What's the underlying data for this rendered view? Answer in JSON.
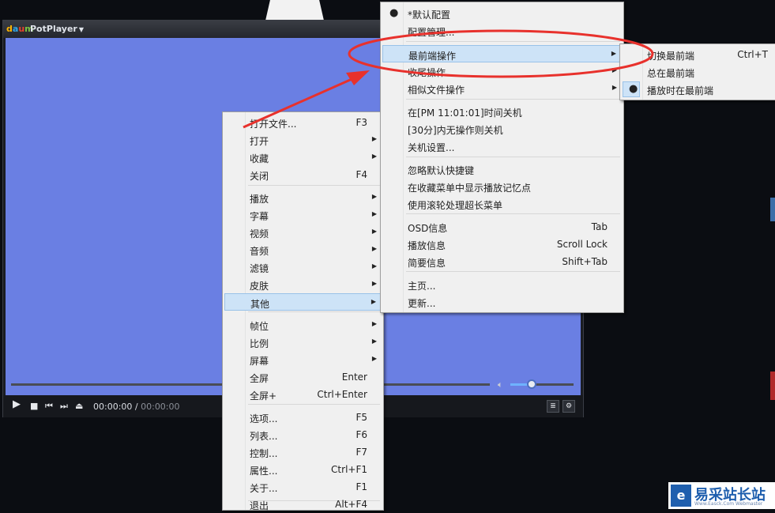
{
  "player": {
    "app_name": "PotPlayer",
    "current_time": "00:00:00 /",
    "duration": "00:00:00"
  },
  "main_menu": {
    "items": [
      {
        "label": "打开文件...",
        "key": "F3",
        "submenu": false
      },
      {
        "label": "打开",
        "key": "",
        "submenu": true
      },
      {
        "label": "收藏",
        "key": "",
        "submenu": true
      },
      {
        "label": "关闭",
        "key": "F4",
        "submenu": false
      },
      {
        "label": "播放",
        "key": "",
        "submenu": true
      },
      {
        "label": "字幕",
        "key": "",
        "submenu": true
      },
      {
        "label": "视频",
        "key": "",
        "submenu": true
      },
      {
        "label": "音频",
        "key": "",
        "submenu": true
      },
      {
        "label": "滤镜",
        "key": "",
        "submenu": true
      },
      {
        "label": "皮肤",
        "key": "",
        "submenu": true
      },
      {
        "label": "其他",
        "key": "",
        "submenu": true,
        "highlighted": true
      },
      {
        "label": "帧位",
        "key": "",
        "submenu": true
      },
      {
        "label": "比例",
        "key": "",
        "submenu": true
      },
      {
        "label": "屏幕",
        "key": "",
        "submenu": true
      },
      {
        "label": "全屏",
        "key": "Enter",
        "submenu": false
      },
      {
        "label": "全屏+",
        "key": "Ctrl+Enter",
        "submenu": false
      },
      {
        "label": "选项...",
        "key": "F5",
        "submenu": false
      },
      {
        "label": "列表...",
        "key": "F6",
        "submenu": false
      },
      {
        "label": "控制...",
        "key": "F7",
        "submenu": false
      },
      {
        "label": "属性...",
        "key": "Ctrl+F1",
        "submenu": false
      },
      {
        "label": "关于...",
        "key": "F1",
        "submenu": false
      },
      {
        "label": "退出",
        "key": "Alt+F4",
        "submenu": false
      }
    ]
  },
  "other_menu": {
    "items": [
      {
        "label": "*默认配置",
        "key": "",
        "submenu": false,
        "checked": true
      },
      {
        "label": "配置管理...",
        "key": "",
        "submenu": false
      },
      {
        "label": "最前端操作",
        "key": "",
        "submenu": true,
        "highlighted": true
      },
      {
        "label": "收尾操作",
        "key": "",
        "submenu": true
      },
      {
        "label": "相似文件操作",
        "key": "",
        "submenu": true
      },
      {
        "label": "在[PM 11:01:01]时间关机",
        "key": "",
        "submenu": false
      },
      {
        "label": "[30分]内无操作则关机",
        "key": "",
        "submenu": false
      },
      {
        "label": "关机设置...",
        "key": "",
        "submenu": false
      },
      {
        "label": "忽略默认快捷键",
        "key": "",
        "submenu": false
      },
      {
        "label": "在收藏菜单中显示播放记忆点",
        "key": "",
        "submenu": false
      },
      {
        "label": "使用滚轮处理超长菜单",
        "key": "",
        "submenu": false
      },
      {
        "label": "OSD信息",
        "key": "Tab",
        "submenu": false
      },
      {
        "label": "播放信息",
        "key": "Scroll Lock",
        "submenu": false
      },
      {
        "label": "简要信息",
        "key": "Shift+Tab",
        "submenu": false
      },
      {
        "label": "主页...",
        "key": "",
        "submenu": false
      },
      {
        "label": "更新...",
        "key": "",
        "submenu": false
      }
    ]
  },
  "topmost_menu": {
    "items": [
      {
        "label": "切换最前端",
        "key": "Ctrl+T",
        "checked": false
      },
      {
        "label": "总在最前端",
        "key": "",
        "checked": false
      },
      {
        "label": "播放时在最前端",
        "key": "",
        "checked": true
      }
    ]
  },
  "watermark": {
    "logo_glyph": "e",
    "text": "易采站长站",
    "sub": "Www.Easck.Com Webmaster"
  },
  "colors": {
    "video_bg": "#6a7fe3",
    "menu_bg": "#f0f0f0",
    "highlight": "#cde3f7",
    "annotation_red": "#e8312c"
  }
}
